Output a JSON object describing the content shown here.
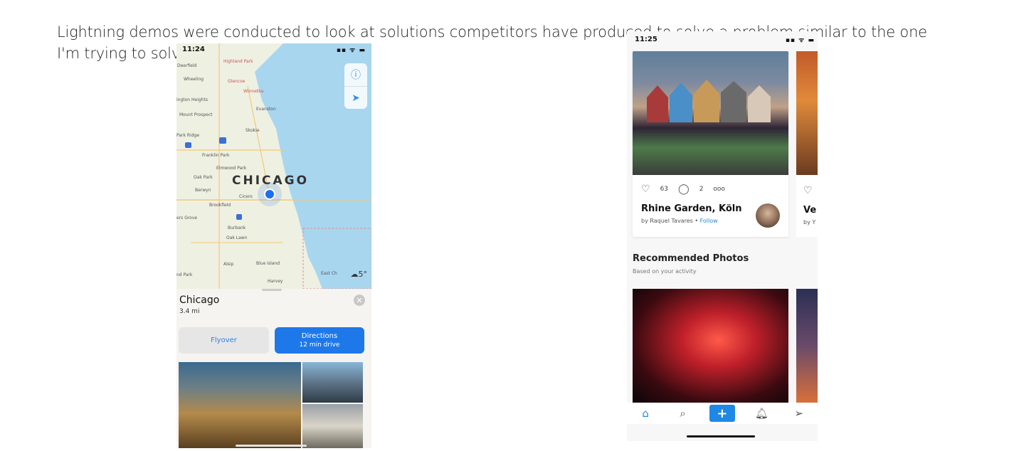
{
  "intro_text": "Lightning demos were conducted to look at solutions competitors have produced to solve a problem similar to the one I'm trying to solve.",
  "maps_demo": {
    "status_time": "11:24",
    "status_icons": "▪▪ ᯤ ▬",
    "info_icon": "info-icon",
    "locate_icon": "location-arrow-icon",
    "map_labels": [
      "Deerfield",
      "Highland Park",
      "Wheeling",
      "Glencoe",
      "Winnetka",
      "ington Heights",
      "Mount Prospect",
      "Evanston",
      "Skokie",
      "Park Ridge",
      "Franklin Park",
      "Elmwood Park",
      "Oak Park",
      "Berwyn",
      "Cicero",
      "Brookfield",
      "ers Grove",
      "Burbank",
      "Oak Lawn",
      "Alsip",
      "Blue Island",
      "nd Park",
      "Harvey",
      "East Ch"
    ],
    "city_label": "CHICAGO",
    "weather": "5°",
    "place_name": "Chicago",
    "place_distance": "3.4 mi",
    "flyover_label": "Flyover",
    "directions_label": "Directions",
    "directions_sub": "12 min drive"
  },
  "photos_demo": {
    "status_time": "11:25",
    "status_icons": "▪▪ ᯤ ▬",
    "likes": "63",
    "comments": "2",
    "more": "ooo",
    "photo_title": "Rhine Garden, Köln",
    "byline_prefix": "by Raquel Tavares •",
    "follow": "Follow",
    "peek_title": "Ve",
    "peek_by": "by Y",
    "rec_title": "Recommended Photos",
    "rec_sub": "Based on your activity",
    "tabs": [
      "home",
      "search",
      "add",
      "bell",
      "send"
    ]
  }
}
